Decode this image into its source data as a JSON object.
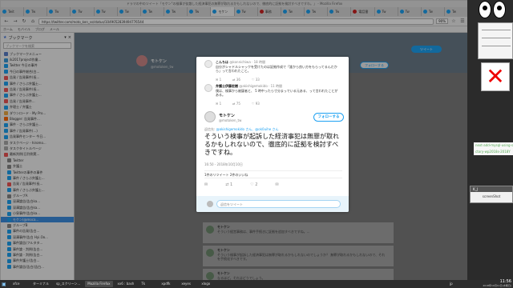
{
  "browser": {
    "title": "ドラマの中のツイート「モケン\"の検事が拡散した経済事犯の無罪が取れるかもしれないので、徹底的に証拠を検討すべきですわ。」 - Mozilla Firefox",
    "tabs": [
      {
        "label": "Twit",
        "active": false
      },
      {
        "label": "Tw",
        "active": false
      },
      {
        "label": "Tw",
        "active": false
      },
      {
        "label": "Tw",
        "active": false
      },
      {
        "label": "Tw",
        "active": false
      },
      {
        "label": "Tw",
        "active": false
      },
      {
        "label": "Tw",
        "active": false
      },
      {
        "label": "Tw",
        "active": false
      },
      {
        "label": "Tw",
        "active": false
      },
      {
        "label": "モケン",
        "active": true
      },
      {
        "label": "Tw",
        "active": false
      },
      {
        "label": "事務",
        "active": false
      },
      {
        "label": "Tw",
        "active": false
      },
      {
        "label": "Tw",
        "active": false
      },
      {
        "label": "Tw",
        "active": false
      },
      {
        "label": "電話番",
        "active": false
      },
      {
        "label": "Tw",
        "active": false
      },
      {
        "label": "Tw",
        "active": false
      },
      {
        "label": "Tw",
        "active": false
      },
      {
        "label": "Tw",
        "active": false
      }
    ],
    "url": "https://twitter.com/moto_ken_ss/status/1049052839494776544",
    "zoom": "90%",
    "bookmarks_toolbar": [
      "ホーム",
      "モバイル",
      "ブログ",
      "メール"
    ]
  },
  "sidebar": {
    "title": "ブックマーク",
    "search_placeholder": "ブックマークを検索",
    "items": [
      {
        "label": "ブックマークメニュー",
        "color": "#5a7fc8",
        "selected": false
      },
      {
        "label": "ik2017project作業...",
        "color": "#3a9ad9",
        "selected": false
      },
      {
        "label": "Twitter 今日の事件",
        "color": "#1da1f2",
        "selected": false
      },
      {
        "label": "今日の事件総合(白...",
        "color": "#1da1f2",
        "selected": false
      },
      {
        "label": "告発 / 告発事件(長...",
        "color": "#e55",
        "selected": false
      },
      {
        "label": "事件 / さらぶ弁護士...",
        "color": "#1da1f2",
        "selected": false
      },
      {
        "label": "告発 / 告発事件(長...",
        "color": "#e55",
        "selected": false
      },
      {
        "label": "事件 / さらぶ弁護士...",
        "color": "#1da1f2",
        "selected": false
      },
      {
        "label": "告発 / 告発事件...",
        "color": "#e55",
        "selected": false
      },
      {
        "label": "弁理士 / 弁護士",
        "color": "#1da1f2",
        "selected": false
      },
      {
        "label": "ダウンロード - My Pro...",
        "color": "#ea4",
        "selected": false
      },
      {
        "label": "Blogger: 告発事件...",
        "color": "#f60",
        "selected": false
      },
      {
        "label": "事件 - さらぶ弁護士...",
        "color": "#1da1f2",
        "selected": false
      },
      {
        "label": "事件 / 告発事件(...)",
        "color": "#1da1f2",
        "selected": false
      },
      {
        "label": "告発事件センター 今日...",
        "color": "#1da1f2",
        "selected": false
      },
      {
        "label": "タスクページ - hiromo...",
        "color": "#aaa",
        "selected": false
      },
      {
        "label": "タスクタイトルページ",
        "color": "#aaa",
        "selected": false
      },
      {
        "label": "最新判例(日判例実...",
        "color": "#e55",
        "selected": false
      },
      {
        "label": "Twitter",
        "color": "#888",
        "selected": false
      },
      {
        "label": "弁護士",
        "color": "#888",
        "selected": false
      },
      {
        "label": "Twitterの事件の事件",
        "color": "#1da1f2",
        "selected": false
      },
      {
        "label": "事件 / さらぶ弁護士...",
        "color": "#1da1f2",
        "selected": false
      },
      {
        "label": "告発 / 告発事件(長...",
        "color": "#e55",
        "selected": false
      },
      {
        "label": "事件 / さらぶ弁護士...",
        "color": "#1da1f2",
        "selected": false
      },
      {
        "label": "グループA",
        "color": "#888",
        "selected": false
      },
      {
        "label": "深澤論告(告白ka...",
        "color": "#1da1f2",
        "selected": false
      },
      {
        "label": "深澤論告(告白ka...",
        "color": "#1da1f2",
        "selected": false
      },
      {
        "label": "小泉事件(告白ka...",
        "color": "#1da1f2",
        "selected": false
      },
      {
        "label": "モケン(@moca...",
        "color": "#1da1f2",
        "selected": true
      },
      {
        "label": "グループB",
        "color": "#888",
        "selected": false
      },
      {
        "label": "事件の告発(告白...",
        "color": "#1da1f2",
        "selected": false
      },
      {
        "label": "深澤事件(告白 Hyi.Oo...",
        "color": "#1da1f2",
        "selected": false
      },
      {
        "label": "事件論告(フルタタ...",
        "color": "#1da1f2",
        "selected": false
      },
      {
        "label": "事件論 - 判例(告白...",
        "color": "#1da1f2",
        "selected": false
      },
      {
        "label": "事件論 - 判例(告白...",
        "color": "#1da1f2",
        "selected": false
      },
      {
        "label": "事件弁護士(告白...",
        "color": "#1da1f2",
        "selected": false
      },
      {
        "label": "事件論告(告白(告白...",
        "color": "#1da1f2",
        "selected": false
      }
    ]
  },
  "profile": {
    "name": "モトケン",
    "handle": "@motoken_tw",
    "follow_label": "フォローする",
    "tweet_label": "ツイート"
  },
  "modal": {
    "rt1": {
      "name": "こんちは",
      "handle": "@konnichiwa · 18 時間",
      "text": "自分がシャドルシャックを受けたのは証拠作成で「誰から良い方をもらってるんだから」って言われたこと。",
      "replies": "1",
      "retweets": "36",
      "likes": "33"
    },
    "rt2": {
      "name": "弁護士伊藤宏樹",
      "handle": "@akishigemokido · 11 時間",
      "text": "僕は、検事から被疑者と、 5 時中ったら寸分まっでいる元ある、って言われたことがある。",
      "replies": "1",
      "retweets": "75",
      "likes": "93"
    },
    "main": {
      "name": "モトケン",
      "handle": "@motoken_tw",
      "follow_label": "フォローする",
      "reply_to_prefix": "返信先:",
      "reply_to_users": "@akishigemokido さん、@ok0uihe さん",
      "text": "そういう検事が起訴した経済事犯は無罪が取れるかもしれないので、徹底的に証拠を検討すべきですね。",
      "timestamp": "16:50 - 2018年10月10日",
      "stats": "1件のリツイート  2件のいいね",
      "replies": "",
      "retweets": "1",
      "likes": "2",
      "reply_placeholder": "返信をツイート"
    }
  },
  "background_tweets": [
    {
      "name": "モトケン",
      "text": "そういう経営事務は、事件手続きに証拠を追加すべきですね。..."
    },
    {
      "name": "モトケン",
      "text": "そういう検事が起訴した経済事犯は無罪が取れるかもしれないのでしょうか？ 無罪が取れるかもしれないので、それを手続化すべきです。"
    },
    {
      "name": "モトケン",
      "text": "なるほど。それはどうでしょう。"
    }
  ],
  "right_panel": {
    "term_lines": [
      "next-add-mysql-using-s",
      "ctory-wp2018s-2018Y"
    ],
    "screenshot_title": "K_J",
    "screenshot_label": "screenShot"
  },
  "taskbar": {
    "items": [
      {
        "label": "xfce",
        "highlight": false
      },
      {
        "label": "ターミナル",
        "highlight": false
      },
      {
        "label": "sp_スクリーン...",
        "highlight": false
      },
      {
        "label": "Mozilla Firefox",
        "highlight": true
      },
      {
        "label": "xx6 : bash",
        "highlight": false
      },
      {
        "label": "Tk",
        "highlight": false
      },
      {
        "label": "xpdfk",
        "highlight": false
      },
      {
        "label": "xeyes",
        "highlight": false
      },
      {
        "label": "xlogo",
        "highlight": false
      }
    ],
    "ime": "jp",
    "time": "11:56",
    "date": "2018年10月11日(木曜日)"
  }
}
